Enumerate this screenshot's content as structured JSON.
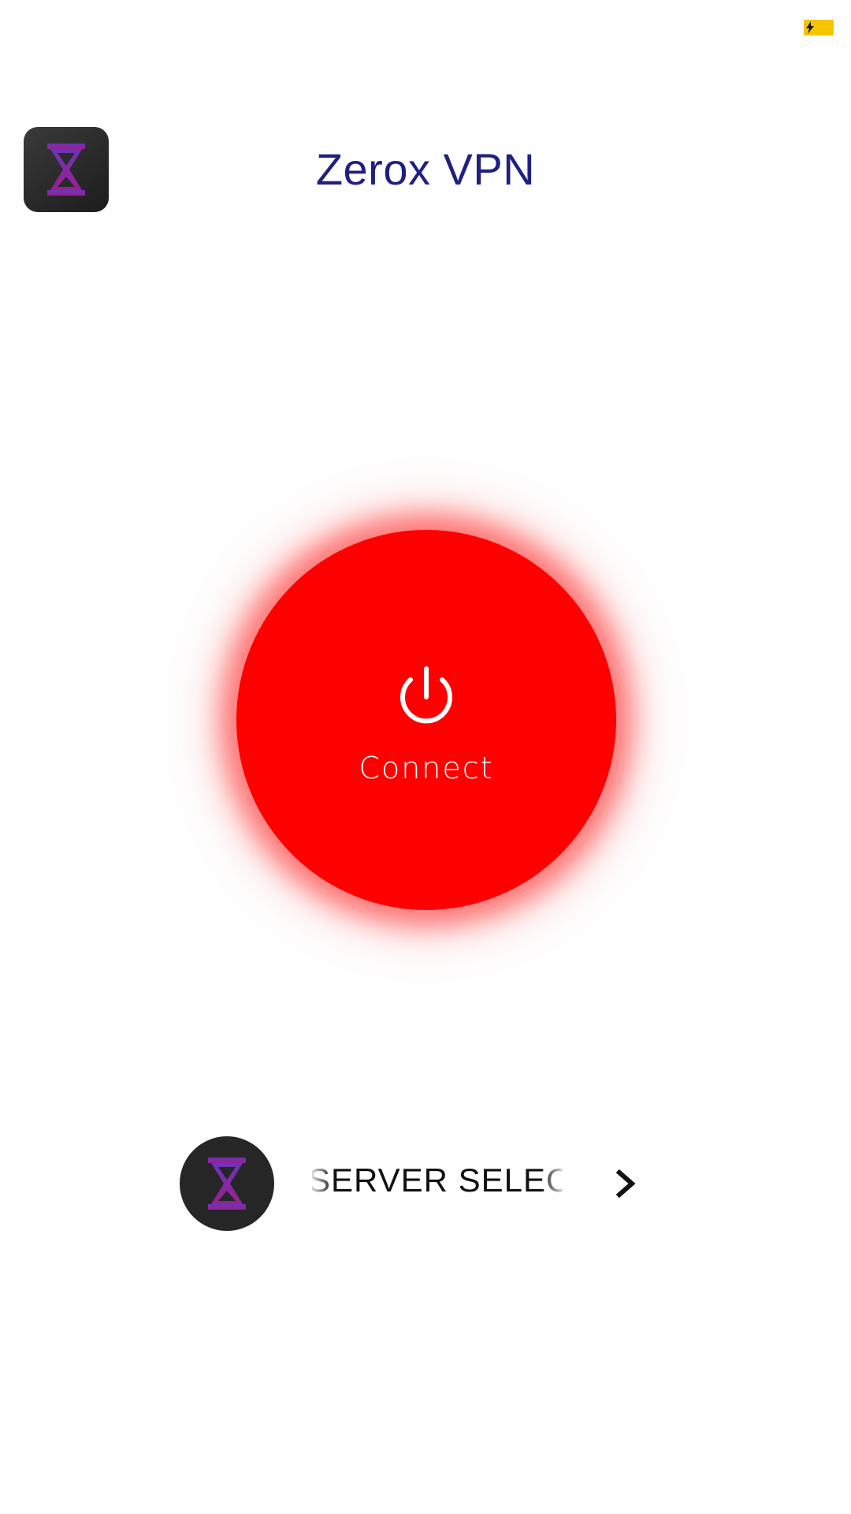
{
  "status_bar": {
    "battery_color": "#f7c500",
    "battery_icon": "battery-charging-icon"
  },
  "header": {
    "app_icon": "hourglass-icon",
    "title": "Zerox VPN",
    "title_color": "#1f2080"
  },
  "main": {
    "connect_button": {
      "label": "Connect",
      "icon": "power-icon",
      "color": "#fe0000"
    }
  },
  "server_select": {
    "avatar_icon": "hourglass-icon",
    "label": "SERVER SELECT",
    "chevron_icon": "chevron-right-icon"
  }
}
